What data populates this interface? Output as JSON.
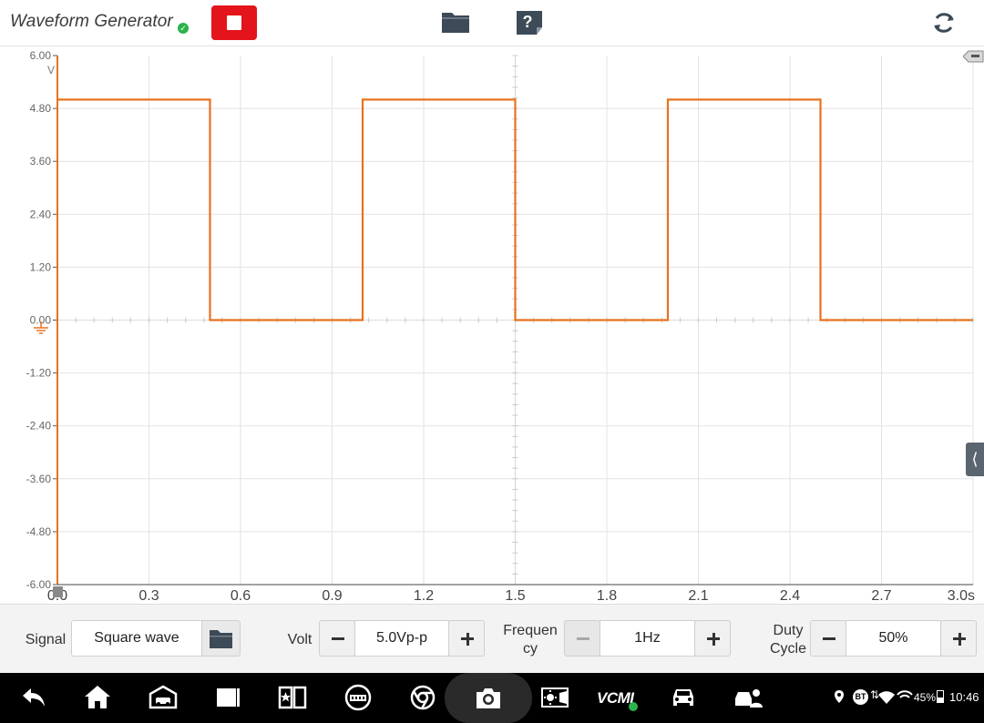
{
  "app": {
    "title": "Waveform Generator",
    "connected_check": "✓"
  },
  "toolbar": {
    "stop_icon": "stop-icon",
    "folder_icon": "folder-icon",
    "help_icon": "help-icon",
    "refresh_icon": "refresh-icon"
  },
  "chart_data": {
    "type": "line",
    "title": "",
    "xlabel": "",
    "ylabel": "",
    "y_unit_label": "V",
    "x_ticks": [
      "0.0",
      "0.3",
      "0.6",
      "0.9",
      "1.2",
      "1.5",
      "1.8",
      "2.1",
      "2.4",
      "2.7",
      "3.0s"
    ],
    "y_ticks": [
      "6.00",
      "4.80",
      "3.60",
      "2.40",
      "1.20",
      "0.00",
      "-1.20",
      "-2.40",
      "-3.60",
      "-4.80",
      "-6.00"
    ],
    "xlim": [
      0,
      3.0
    ],
    "ylim": [
      -6.0,
      6.0
    ],
    "grid": true,
    "series": [
      {
        "color": "#e8721e",
        "x": [
          0.0,
          0.5,
          0.5,
          1.0,
          1.0,
          1.5,
          1.5,
          2.0,
          2.0,
          2.5,
          2.5,
          3.0
        ],
        "y": [
          5.0,
          5.0,
          0.0,
          0.0,
          5.0,
          5.0,
          0.0,
          0.0,
          5.0,
          5.0,
          0.0,
          0.0
        ]
      }
    ]
  },
  "controls": {
    "signal": {
      "label": "Signal",
      "value": "Square wave"
    },
    "volt": {
      "label": "Volt",
      "value": "5.0Vp-p"
    },
    "frequency": {
      "label_line1": "Frequen",
      "label_line2": "cy",
      "value": "1Hz",
      "minus_disabled": true
    },
    "duty": {
      "label_line1": "Duty",
      "label_line2": "Cycle",
      "value": "50%"
    }
  },
  "status_bar": {
    "battery": "45%",
    "time": "10:46"
  },
  "nav": {
    "vcm_label": "VCMI"
  },
  "colors": {
    "accent_red": "#e3141b",
    "waveform": "#e8721e",
    "icon_dark": "#3d4a57"
  }
}
